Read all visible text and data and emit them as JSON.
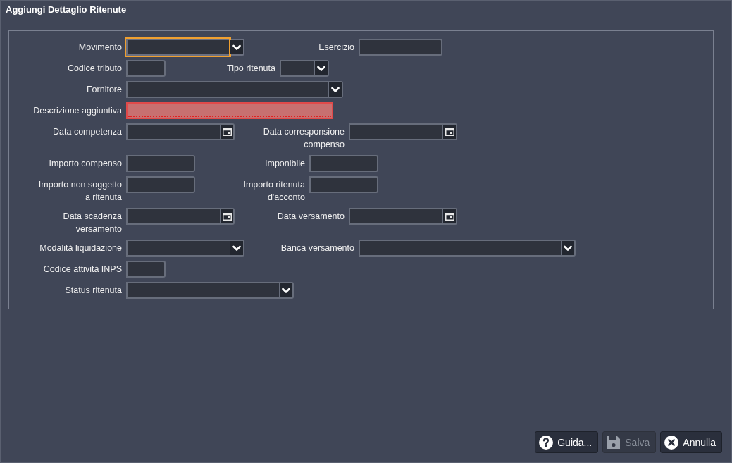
{
  "window": {
    "title": "Aggiungi Dettaglio Ritenute"
  },
  "rows": [
    {
      "fields": [
        {
          "label": "Movimento",
          "kind": "combo",
          "focused": true,
          "invalid": false
        },
        {
          "label": "Esercizio",
          "kind": "text",
          "focused": false,
          "invalid": false
        }
      ]
    },
    {
      "fields": [
        {
          "label": "Codice tributo",
          "kind": "text",
          "focused": false,
          "invalid": false
        },
        {
          "label": "Tipo ritenuta",
          "kind": "combo",
          "focused": false,
          "invalid": false
        }
      ]
    },
    {
      "fields": [
        {
          "label": "Fornitore",
          "kind": "combo",
          "focused": false,
          "invalid": false
        }
      ]
    },
    {
      "fields": [
        {
          "label": "Descrizione aggiuntiva",
          "kind": "text",
          "focused": false,
          "invalid": true
        }
      ]
    },
    {
      "fields": [
        {
          "label": "Data competenza",
          "kind": "date",
          "focused": false,
          "invalid": false
        },
        {
          "label": "Data corresponsione\ncompenso",
          "kind": "date",
          "focused": false,
          "invalid": false
        }
      ]
    },
    {
      "fields": [
        {
          "label": "Importo compenso",
          "kind": "text",
          "focused": false,
          "invalid": false
        },
        {
          "label": "Imponibile",
          "kind": "text",
          "focused": false,
          "invalid": false
        }
      ]
    },
    {
      "fields": [
        {
          "label": "Importo non soggetto\na ritenuta",
          "kind": "text",
          "focused": false,
          "invalid": false
        },
        {
          "label": "Importo ritenuta\nd'acconto",
          "kind": "text",
          "focused": false,
          "invalid": false
        }
      ]
    },
    {
      "fields": [
        {
          "label": "Data scadenza\nversamento",
          "kind": "date",
          "focused": false,
          "invalid": false
        },
        {
          "label": "Data versamento",
          "kind": "date",
          "focused": false,
          "invalid": false
        }
      ]
    },
    {
      "fields": [
        {
          "label": "Modalità liquidazione",
          "kind": "combo",
          "focused": false,
          "invalid": false
        },
        {
          "label": "Banca versamento",
          "kind": "combo",
          "focused": false,
          "invalid": false
        }
      ]
    },
    {
      "fields": [
        {
          "label": "Codice attività INPS",
          "kind": "text",
          "focused": false,
          "invalid": false
        }
      ]
    },
    {
      "fields": [
        {
          "label": "Status ritenuta",
          "kind": "combo",
          "focused": false,
          "invalid": false
        }
      ]
    }
  ],
  "buttons": [
    {
      "label": "Guida...",
      "kind": "help",
      "disabled": false
    },
    {
      "label": "Salva",
      "kind": "save",
      "disabled": true
    },
    {
      "label": "Annulla",
      "kind": "cancel",
      "disabled": false
    }
  ]
}
